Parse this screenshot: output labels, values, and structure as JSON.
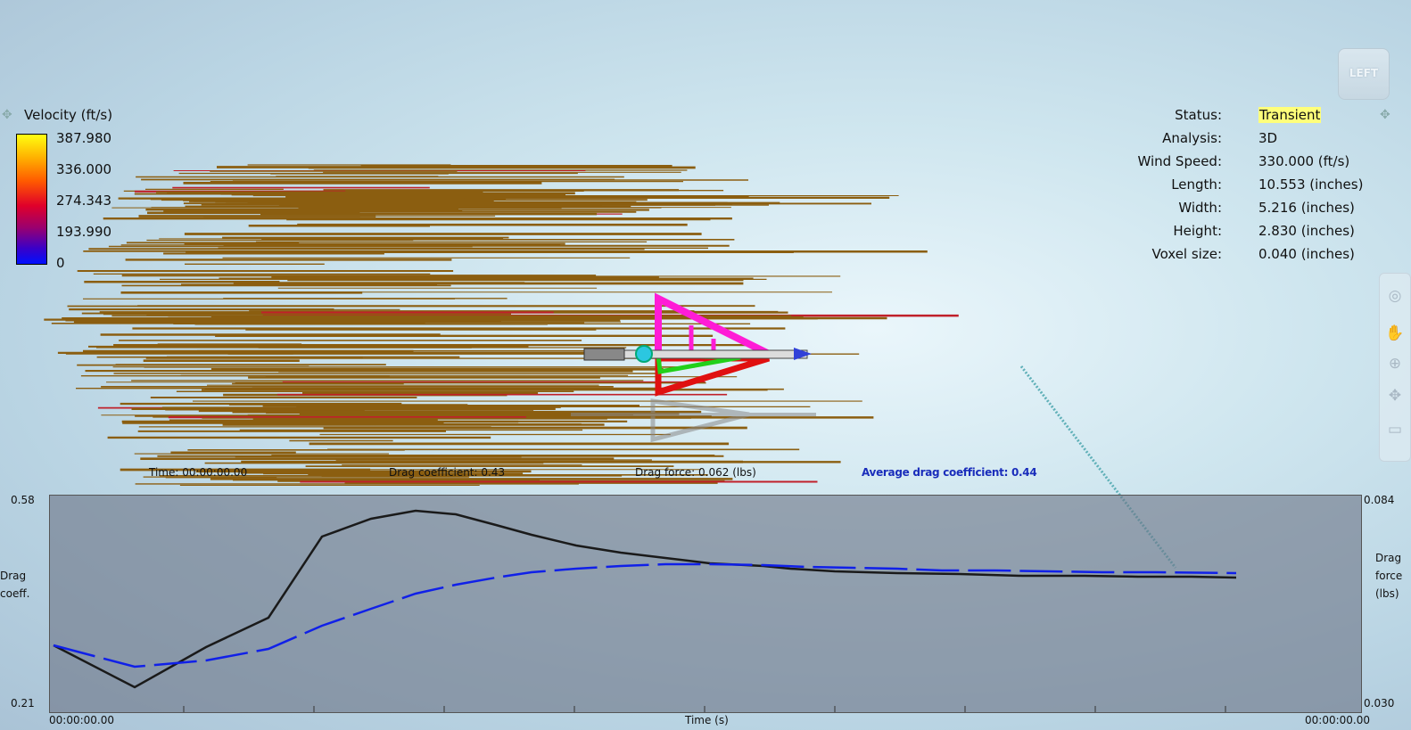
{
  "legend": {
    "title": "Velocity (ft/s)",
    "values": [
      "387.980",
      "336.000",
      "274.343",
      "193.990",
      "0"
    ],
    "move_icon": "move-icon"
  },
  "info": {
    "rows": [
      {
        "label": "Status:",
        "value": "Transient"
      },
      {
        "label": "Analysis:",
        "value": "3D"
      },
      {
        "label": "Wind Speed:",
        "value": "330.000 (ft/s)"
      },
      {
        "label": "Length:",
        "value": "10.553 (inches)"
      },
      {
        "label": "Width:",
        "value": "5.216 (inches)"
      },
      {
        "label": "Height:",
        "value": "2.830 (inches)"
      },
      {
        "label": "Voxel size:",
        "value": "0.040 (inches)"
      }
    ],
    "status_highlight_color": "#ffff7a"
  },
  "view_cube": {
    "face_label": "LEFT"
  },
  "toolbar": {
    "icons": [
      "rotate-icon",
      "pan-hand-icon",
      "zoom-icon",
      "orbit-icon",
      "window-icon"
    ]
  },
  "stats": {
    "time": "Time: 00:00:00.00",
    "drag_coefficient": "Drag coefficient: 0.43",
    "drag_force": "Drag force: 0.062 (lbs)",
    "avg_drag": "Average drag coefficient: 0.44"
  },
  "plot": {
    "left_axis": {
      "label_line1": "Drag",
      "label_line2": "coeff.",
      "max": "0.58",
      "min": "0.21"
    },
    "right_axis": {
      "label_line1": "Drag",
      "label_line2": "force",
      "label_line3": "(lbs)",
      "max": "0.084",
      "min": "0.030"
    },
    "x_axis": {
      "label": "Time (s)",
      "start": "00:00:00.00",
      "end": "00:00:00.00"
    },
    "colors": {
      "drag_coeff": "#1a1a1a",
      "drag_force": "#1020e8"
    }
  }
}
